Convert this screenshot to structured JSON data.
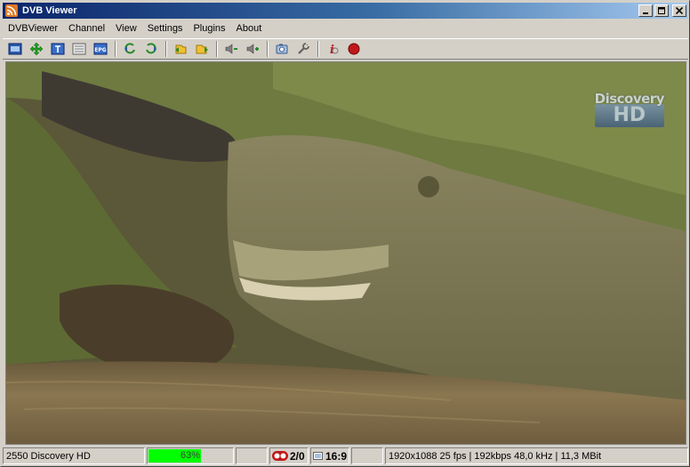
{
  "window": {
    "title": "DVB Viewer",
    "app_icon": "rss-icon"
  },
  "menu": {
    "items": [
      "DVBViewer",
      "Channel",
      "View",
      "Settings",
      "Plugins",
      "About"
    ]
  },
  "toolbar": {
    "buttons": [
      {
        "name": "tv-window-icon"
      },
      {
        "name": "move-icon"
      },
      {
        "name": "teletext-icon"
      },
      {
        "name": "list-icon"
      },
      {
        "name": "epg-icon"
      },
      {
        "name": "previous-channel-icon"
      },
      {
        "name": "next-channel-icon"
      },
      {
        "name": "favorite-back-icon"
      },
      {
        "name": "favorite-forward-icon"
      },
      {
        "name": "volume-down-icon"
      },
      {
        "name": "volume-up-icon"
      },
      {
        "name": "snapshot-icon"
      },
      {
        "name": "tools-icon"
      },
      {
        "name": "info-icon"
      },
      {
        "name": "record-icon"
      }
    ]
  },
  "video": {
    "watermark_top": "Discovery",
    "watermark_bottom": "HD"
  },
  "status": {
    "channel": "2550 Discovery HD",
    "signal_text": "63%",
    "signal_fraction": 0.63,
    "signal_color": "#00ff00",
    "recordings": "2/0",
    "aspect": "16:9",
    "stream_info": "1920x1088 25 fps | 192kbps 48,0 kHz | 11,3 MBit"
  },
  "colors": {
    "titlebar_start": "#0a246a",
    "titlebar_end": "#a6caf0",
    "chrome": "#d4d0c8"
  }
}
